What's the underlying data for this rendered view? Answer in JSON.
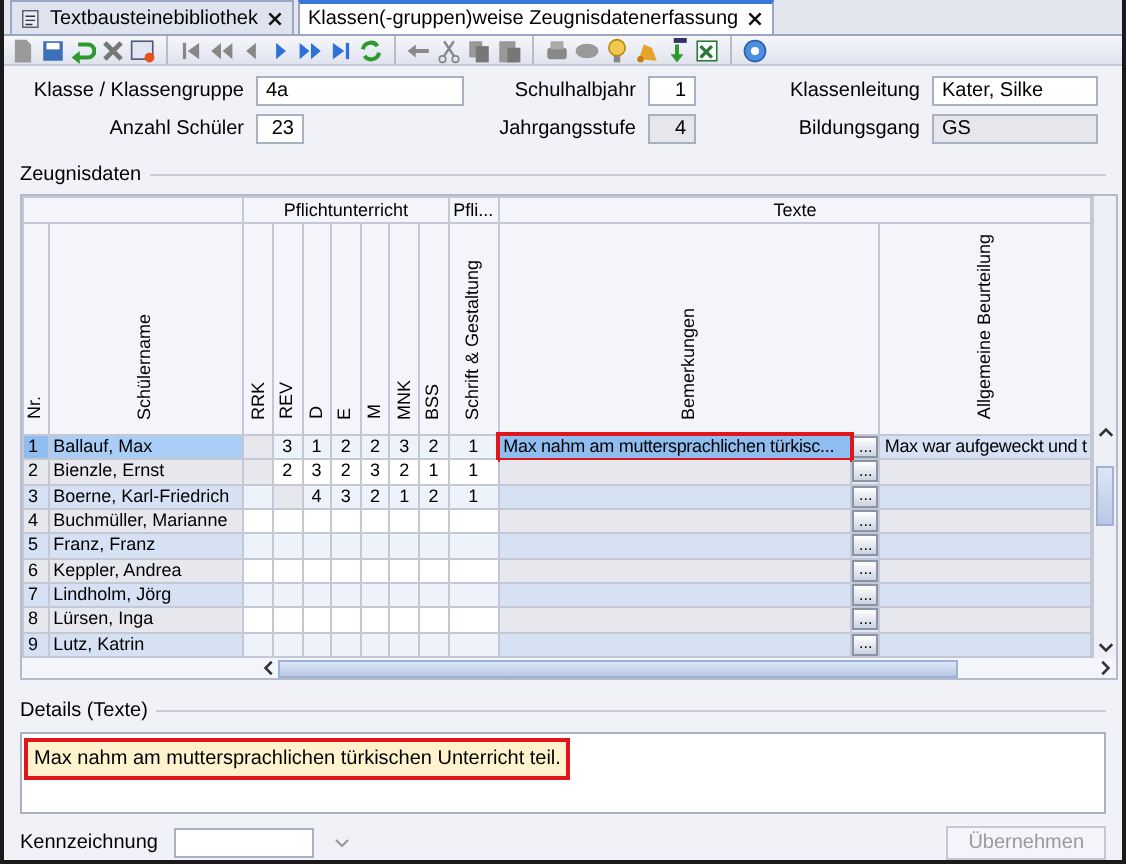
{
  "tabs": [
    {
      "label": "Textbausteinebibliothek",
      "selected": false
    },
    {
      "label": "Klassen(-gruppen)weise Zeugnisdatenerfassung",
      "selected": true
    }
  ],
  "header_fields": [
    {
      "label": "Klasse / Klassengruppe",
      "value": "4a",
      "readonly": false,
      "kind": "wide"
    },
    {
      "label": "Schulhalbjahr",
      "value": "1",
      "readonly": false,
      "kind": "short"
    },
    {
      "label": "Klassenleitung",
      "value": "Kater, Silke",
      "readonly": false,
      "kind": "wide"
    },
    {
      "label": "Anzahl Schüler",
      "value": "23",
      "readonly": false,
      "kind": "short"
    },
    {
      "label": "Jahrgangsstufe",
      "value": "4",
      "readonly": true,
      "kind": "short"
    },
    {
      "label": "Bildungsgang",
      "value": "GS",
      "readonly": true,
      "kind": "wide"
    }
  ],
  "grid": {
    "title": "Zeugnisdaten",
    "column_groups": [
      {
        "columns": [
          {
            "label": "Nr.",
            "kind": "number"
          },
          {
            "label": "Schülername",
            "kind": "name"
          }
        ]
      },
      {
        "label": "Pflichtunterricht",
        "columns": [
          {
            "label": "RRK",
            "kind": "grade"
          },
          {
            "label": "REV",
            "kind": "grade"
          },
          {
            "label": "D",
            "kind": "grade"
          },
          {
            "label": "E",
            "kind": "grade"
          },
          {
            "label": "M",
            "kind": "grade"
          },
          {
            "label": "MNK",
            "kind": "grade"
          },
          {
            "label": "BSS",
            "kind": "grade"
          }
        ]
      },
      {
        "label": "Pfli...",
        "columns": [
          {
            "label": "Schrift & Gestaltung",
            "kind": "grade"
          }
        ]
      },
      {
        "label": "Texte",
        "columns": [
          {
            "label": "Bemerkungen",
            "kind": "text"
          },
          {
            "label": "Allgemeine Beurteilung",
            "kind": "text"
          }
        ]
      }
    ],
    "rows": [
      {
        "nr": "1",
        "name": "Ballauf, Max",
        "selected": true,
        "grades": [
          {
            "editable": false
          },
          {
            "value": "3",
            "editable": true
          },
          {
            "value": "1",
            "editable": true
          },
          {
            "value": "2",
            "editable": true
          },
          {
            "value": "2",
            "editable": true
          },
          {
            "value": "3",
            "editable": true
          },
          {
            "value": "2",
            "editable": true
          },
          {
            "value": "1",
            "editable": true
          }
        ],
        "texts": [
          "Max nahm am muttersprachlichen türkisc...",
          "Max war aufgeweckt und t"
        ],
        "button": "...",
        "marked": true
      },
      {
        "nr": "2",
        "name": "Bienzle, Ernst",
        "selected": false,
        "grades": [
          {
            "editable": false
          },
          {
            "value": "2",
            "editable": true
          },
          {
            "value": "3",
            "editable": true
          },
          {
            "value": "2",
            "editable": true
          },
          {
            "value": "3",
            "editable": true
          },
          {
            "value": "2",
            "editable": true
          },
          {
            "value": "1",
            "editable": true
          },
          {
            "value": "1",
            "editable": true
          }
        ],
        "texts": [],
        "button": "...",
        "marked": false
      },
      {
        "nr": "3",
        "name": "Boerne, Karl-Friedrich",
        "selected": false,
        "grades": [
          {
            "editable": true
          },
          {
            "editable": false
          },
          {
            "value": "4",
            "editable": true
          },
          {
            "value": "3",
            "editable": true
          },
          {
            "value": "2",
            "editable": true
          },
          {
            "value": "1",
            "editable": true
          },
          {
            "value": "2",
            "editable": true
          },
          {
            "value": "1",
            "editable": true
          }
        ],
        "texts": [],
        "button": "...",
        "marked": false
      },
      {
        "nr": "4",
        "name": "Buchmüller, Marianne",
        "selected": false,
        "grades": [],
        "texts": [],
        "button": "...",
        "marked": false
      },
      {
        "nr": "5",
        "name": "Franz, Franz",
        "selected": false,
        "grades": [],
        "texts": [],
        "button": "...",
        "marked": false
      },
      {
        "nr": "6",
        "name": "Keppler, Andrea",
        "selected": false,
        "grades": [],
        "texts": [],
        "button": "...",
        "marked": false
      },
      {
        "nr": "7",
        "name": "Lindholm, Jörg",
        "selected": false,
        "grades": [],
        "texts": [],
        "button": "...",
        "marked": false
      },
      {
        "nr": "8",
        "name": "Lürsen, Inga",
        "selected": false,
        "grades": [],
        "texts": [],
        "button": "...",
        "marked": false
      },
      {
        "nr": "9",
        "name": "Lutz, Katrin",
        "selected": false,
        "grades": [],
        "texts": [],
        "button": "...",
        "marked": false
      }
    ]
  },
  "details": {
    "title": "Details (Texte)",
    "text": "Max nahm am muttersprachlichen türkischen Unterricht teil.",
    "marked": true
  },
  "kennzeichnung": {
    "label": "Kennzeichnung"
  },
  "apply_button": {
    "label": "Übernehmen",
    "disabled": true
  }
}
